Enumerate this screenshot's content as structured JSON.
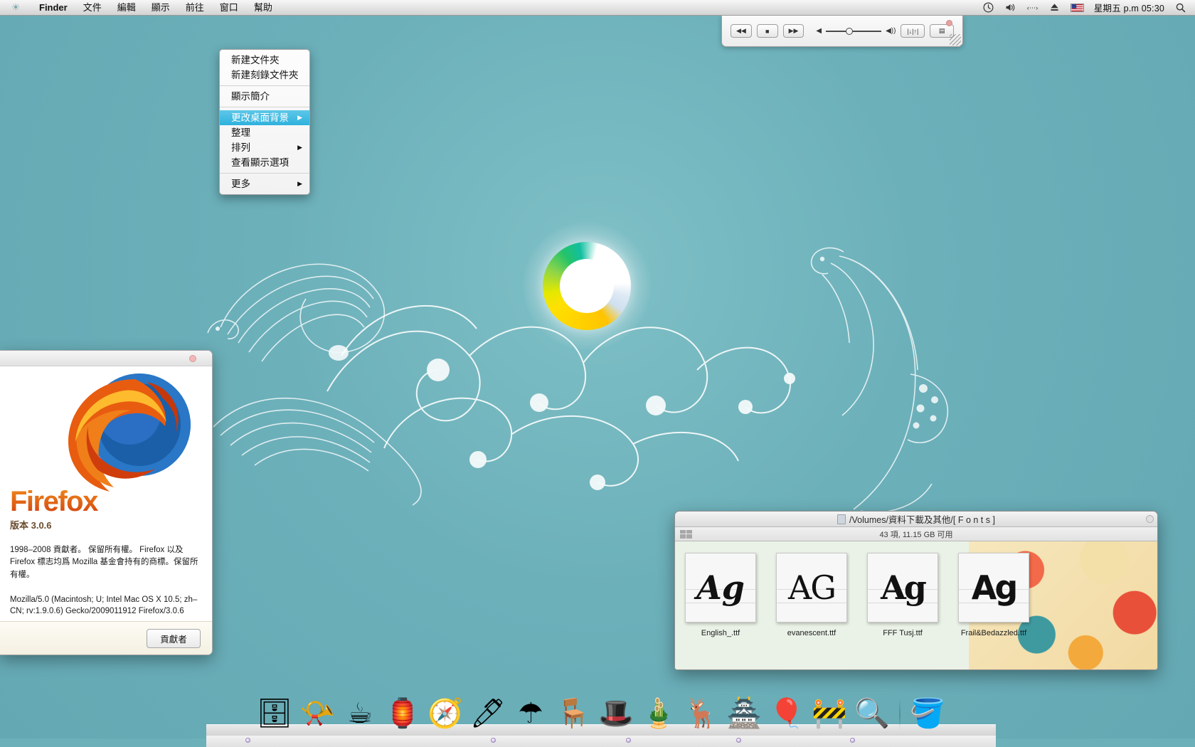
{
  "menubar": {
    "apple_icon": "apple-icon",
    "app_name": "Finder",
    "items": [
      "文件",
      "編輯",
      "顯示",
      "前往",
      "窗口",
      "幫助"
    ],
    "status_icons": [
      "time-machine-icon",
      "volume-icon",
      "bluetooth-icon",
      "eject-icon"
    ],
    "flag": "us-flag-icon",
    "clock": "星期五 p.m 05:30",
    "spotlight": "search-icon"
  },
  "context_menu": {
    "groups": [
      [
        "新建文件夾",
        "新建刻錄文件夾"
      ],
      [
        "顯示簡介"
      ],
      [
        "更改桌面背景",
        "整理",
        "排列",
        "查看顯示選項"
      ],
      [
        "更多"
      ]
    ],
    "selected": "更改桌面背景",
    "submenu_items": [
      "排列",
      "更多"
    ],
    "arrow_glyph": "▶"
  },
  "mini_player": {
    "buttons": [
      {
        "name": "previous-button",
        "glyph": "◀◀"
      },
      {
        "name": "stop-button",
        "glyph": "■"
      },
      {
        "name": "next-button",
        "glyph": "▶▶"
      }
    ],
    "volume_low_icon": "◀",
    "volume_high_icon": "◀))",
    "equalizer_label": "|↓|↑|",
    "playlist_label": "▤",
    "close_icon": "close-icon",
    "resize_grip": "resize-grip-icon"
  },
  "firefox": {
    "wordmark": "Firefox",
    "version_label": "版本 3.0.6",
    "copyright": "1998–2008 貢獻者。 保留所有權。 Firefox 以及 Firefox 標志均爲 Mozilla 基金會持有的商標。保留所有權。",
    "useragent": "Mozilla/5.0 (Macintosh; U; Intel Mac OS X 10.5; zh–CN; rv:1.9.0.6) Gecko/2009011912 Firefox/3.0.6",
    "contributors_button": "貢獻者",
    "close_icon": "close-icon"
  },
  "finder": {
    "title": "/Volumes/資料下載及其他/[ F o n t s ]",
    "doc_icon": "folder-icon",
    "status": "43 項, 11.15 GB 可用",
    "view_toggle": "grid-view-icon",
    "resize_icon": "resize-icon",
    "files": [
      {
        "name": "English_.ttf",
        "sample": "Ag",
        "style": "ag-script"
      },
      {
        "name": "evanescent.ttf",
        "sample": "AG",
        "style": "ag-thin"
      },
      {
        "name": "FFF Tusj.ttf",
        "sample": "Ag",
        "style": "ag-sketch"
      },
      {
        "name": "Frail&Bedazzled.ttf",
        "sample": "Ag",
        "style": "ag-bold"
      }
    ]
  },
  "dock": {
    "items": [
      {
        "name": "dock-item-bookshelf",
        "glyph": "🗄"
      },
      {
        "name": "dock-item-gramophone",
        "glyph": "📯"
      },
      {
        "name": "dock-item-teacup",
        "glyph": "☕"
      },
      {
        "name": "dock-item-lamp",
        "glyph": "🏮"
      },
      {
        "name": "dock-item-compass",
        "glyph": "🧭"
      },
      {
        "name": "dock-item-photoshop",
        "glyph": "🖊"
      },
      {
        "name": "dock-item-umbrella",
        "glyph": "☂"
      },
      {
        "name": "dock-item-armchair",
        "glyph": "🪑"
      },
      {
        "name": "dock-item-tophat",
        "glyph": "🎩"
      },
      {
        "name": "dock-item-bamboo",
        "glyph": "🎍"
      },
      {
        "name": "dock-item-chopper",
        "glyph": "🦌"
      },
      {
        "name": "dock-item-samurai-helmet",
        "glyph": "🏯"
      },
      {
        "name": "dock-item-balloon",
        "glyph": "🎈"
      },
      {
        "name": "dock-item-vlc",
        "glyph": "🚧"
      },
      {
        "name": "dock-item-magnifier",
        "glyph": "🔍"
      },
      {
        "name": "dock-item-bucket",
        "glyph": "🪣"
      }
    ],
    "running_indicator": "running-dot"
  },
  "desktop": {
    "background_color": "#6cb0ba",
    "ornament": "ornamental-birds-illustration",
    "colorwheel": "color-wheel-graphic"
  }
}
